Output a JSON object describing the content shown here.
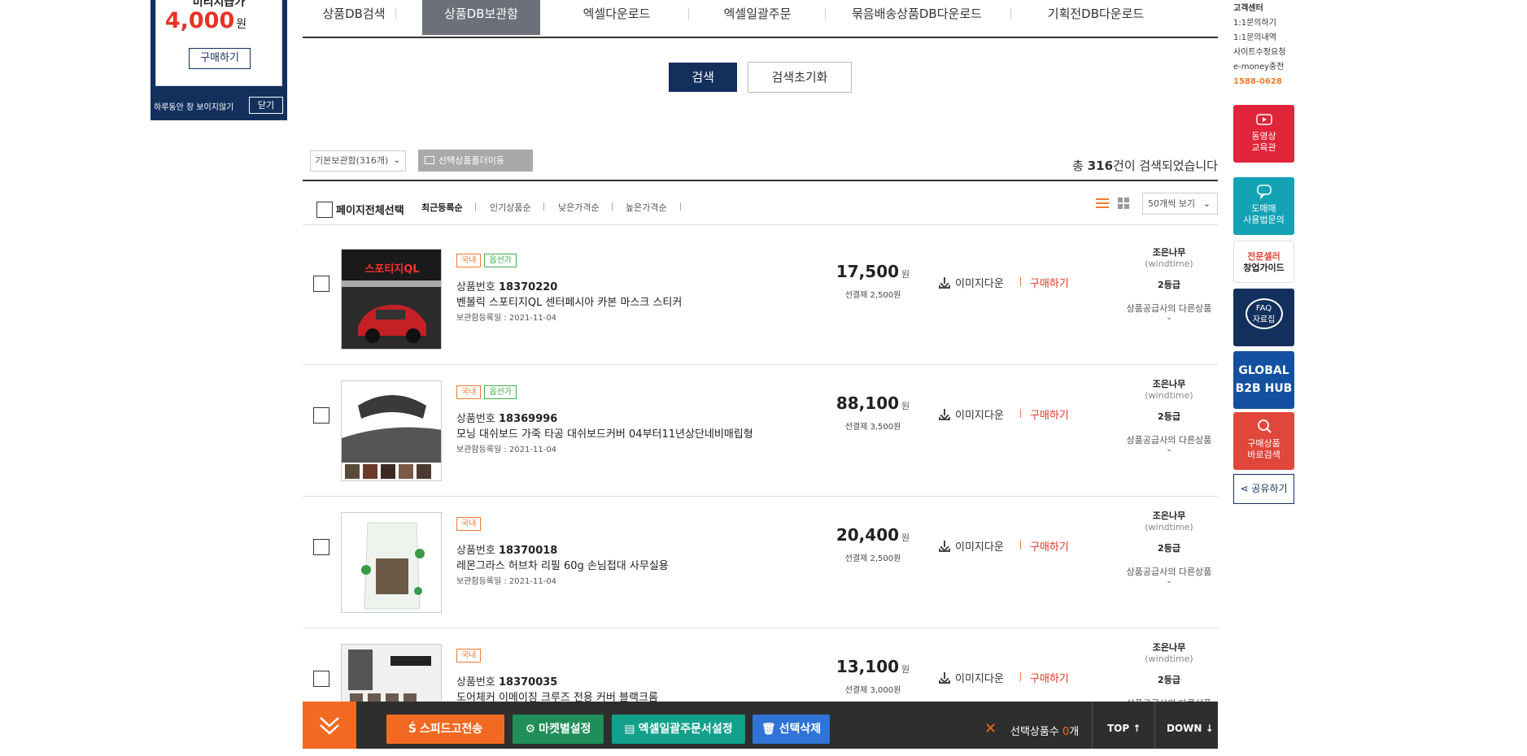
{
  "left_banner": {
    "partial_text": "미리지급가",
    "price": "4,000",
    "price_unit": "원",
    "buy_label": "구매하기",
    "hide_today": "하루동안 창 보이지않기",
    "close_label": "닫기"
  },
  "tabs": [
    {
      "label": "상품DB검색",
      "active": false
    },
    {
      "label": "상품DB보관함",
      "active": true
    },
    {
      "label": "엑셀다운로드",
      "active": false
    },
    {
      "label": "엑셀일괄주문",
      "active": false
    },
    {
      "label": "묶음배송상품DB다운로드",
      "active": false
    },
    {
      "label": "기획전DB다운로드",
      "active": false
    }
  ],
  "search": {
    "search_label": "검색",
    "reset_label": "검색초기화"
  },
  "folder": {
    "selected": "기본보관함(316개)",
    "move_label": "선택상품폴더이동"
  },
  "result": {
    "prefix": "총",
    "count": "316",
    "suffix": "건이 검색되었습니다"
  },
  "sort": {
    "select_all": "페이지전체선택",
    "options": [
      "최근등록순",
      "인기상품순",
      "낮은가격순",
      "높은가격순"
    ],
    "active_index": 0,
    "per_page": "50개씩 보기"
  },
  "products": [
    {
      "badges": [
        "국내",
        "옵션가"
      ],
      "no_label": "상품번호",
      "no": "18370220",
      "name": "벤볼릭 스포티지QL 센터페시아 카본 마스크 스티커",
      "date": "보관함등록일 : 2021-11-04",
      "price": "17,500",
      "unit": "원",
      "ship": "선결제 2,500원",
      "img_down": "이미지다운",
      "buy": "구매하기",
      "seller_name": "조은나무",
      "seller_id": "(windtime)",
      "grade": "2등급",
      "other": "상품공급사의 다른상품",
      "thumb_text": "스포티지QL"
    },
    {
      "badges": [
        "국내",
        "옵션가"
      ],
      "no_label": "상품번호",
      "no": "18369996",
      "name": "모닝 대쉬보드 가죽 타공 대쉬보드커버 04부터11년상단네비매립형",
      "date": "보관함등록일 : 2021-11-04",
      "price": "88,100",
      "unit": "원",
      "ship": "선결제 3,500원",
      "img_down": "이미지다운",
      "buy": "구매하기",
      "seller_name": "조은나무",
      "seller_id": "(windtime)",
      "grade": "2등급",
      "other": "상품공급사의 다른상품"
    },
    {
      "badges": [
        "국내"
      ],
      "no_label": "상품번호",
      "no": "18370018",
      "name": "레몬그라스 허브차 리필 60g 손님접대 사무실용",
      "date": "보관함등록일 : 2021-11-04",
      "price": "20,400",
      "unit": "원",
      "ship": "선결제 2,500원",
      "img_down": "이미지다운",
      "buy": "구매하기",
      "seller_name": "조은나무",
      "seller_id": "(windtime)",
      "grade": "2등급",
      "other": "상품공급사의 다른상품"
    },
    {
      "badges": [
        "국내"
      ],
      "no_label": "상품번호",
      "no": "18370035",
      "name": "도어체커 이메이징 크루즈 전용 커버 블랙크롬",
      "date": "",
      "price": "13,100",
      "unit": "원",
      "ship": "선결제 3,000원",
      "img_down": "이미지다운",
      "buy": "구매하기",
      "seller_name": "조은나무",
      "seller_id": "(windtime)",
      "grade": "2등급",
      "other": "상품공급사의 다른상품"
    }
  ],
  "sidebar": {
    "cs_title": "고객센터",
    "links": [
      "1:1문의하기",
      "1:1문의내역",
      "사이트수정요청",
      "e-money충전"
    ],
    "tel": "1588-0628",
    "buttons": [
      {
        "label1": "동영상",
        "label2": "교육관",
        "color": "#e0243a"
      },
      {
        "label1": "도매매",
        "label2": "사용법문의",
        "color": "#13a3b5"
      },
      {
        "label1": "전문셀러",
        "label2": "창업가이드",
        "color": "#ffffff"
      },
      {
        "label1": "FAQ",
        "label2": "자료집",
        "color": "#13305d"
      },
      {
        "label1": "GLOBAL",
        "label2": "B2B HUB",
        "color": "#13509f"
      },
      {
        "label1": "구매상품",
        "label2": "바로검색",
        "color": "#e0463a"
      }
    ],
    "share": "공유하기"
  },
  "bottom_bar": {
    "speed_send": "스피드고전송",
    "market_setting": "마켓별설정",
    "excel_setting": "엑셀일괄주문서설정",
    "delete_selected": "선택삭제",
    "selected_label": "선택상품수",
    "selected_count": "0",
    "selected_unit": "개",
    "top": "TOP",
    "down": "DOWN"
  }
}
